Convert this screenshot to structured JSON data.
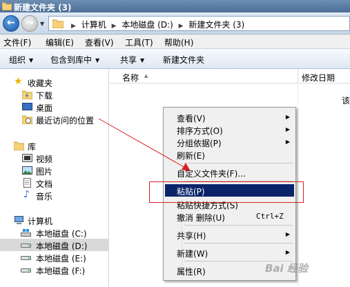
{
  "window": {
    "title": "新建文件夹 (3)"
  },
  "address": {
    "path": [
      "计算机",
      "本地磁盘 (D:)",
      "新建文件夹 (3)"
    ]
  },
  "menubar": [
    "文件(F)",
    "编辑(E)",
    "查看(V)",
    "工具(T)",
    "帮助(H)"
  ],
  "toolbar": {
    "organize": "组织",
    "include_library": "包含到库中",
    "share": "共享",
    "new_folder": "新建文件夹"
  },
  "navpane": {
    "favorites": {
      "label": "收藏夹",
      "items": [
        "下载",
        "桌面",
        "最近访问的位置"
      ]
    },
    "libraries": {
      "label": "库",
      "items": [
        "视频",
        "图片",
        "文档",
        "音乐"
      ]
    },
    "computer": {
      "label": "计算机",
      "items": [
        "本地磁盘 (C:)",
        "本地磁盘 (D:)",
        "本地磁盘 (E:)",
        "本地磁盘 (F:)"
      ],
      "selected_index": 1
    }
  },
  "columns": {
    "name": "名称",
    "date_modified": "修改日期"
  },
  "content": {
    "empty_text": "该"
  },
  "context_menu": {
    "items": [
      {
        "label": "查看(V)",
        "submenu": true
      },
      {
        "label": "排序方式(O)",
        "submenu": true
      },
      {
        "label": "分组依据(P)",
        "submenu": true
      },
      {
        "label": "刷新(E)"
      },
      {
        "label": "自定义文件夹(F)..."
      },
      {
        "label": "粘贴(P)",
        "highlighted": true
      },
      {
        "label": "粘贴快捷方式(S)"
      },
      {
        "label": "撤消 删除(U)",
        "shortcut": "Ctrl+Z"
      },
      {
        "label": "共享(H)",
        "submenu": true
      },
      {
        "label": "新建(W)",
        "submenu": true
      },
      {
        "label": "属性(R)"
      }
    ]
  },
  "watermark": {
    "text": "Bai 经验"
  },
  "colors": {
    "highlight": "#0a246a",
    "annotation": "#d52020"
  },
  "icons": {
    "back": "back-arrow-icon",
    "forward": "forward-arrow-icon",
    "submenu": "chevron-right-icon"
  }
}
